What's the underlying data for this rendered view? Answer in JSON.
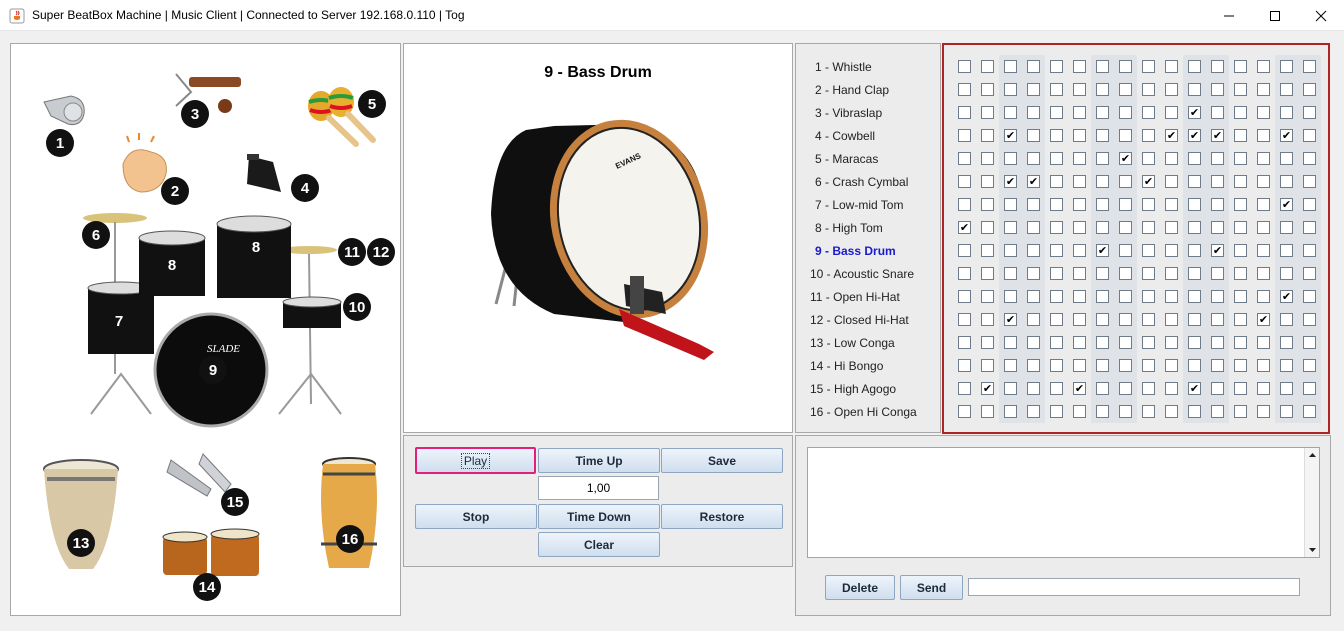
{
  "window": {
    "title": "Super BeatBox Machine | Music Client | Connected to Server 192.168.0.110 | Tog"
  },
  "instrument_image": {
    "numbers": [
      "1",
      "2",
      "3",
      "4",
      "5",
      "6",
      "7",
      "8",
      "8",
      "9",
      "10",
      "11",
      "12",
      "13",
      "14",
      "15",
      "16"
    ]
  },
  "preview": {
    "title": "9 - Bass Drum",
    "drum_brand": "EVANS"
  },
  "controls": {
    "play": "Play",
    "time_up": "Time Up",
    "save": "Save",
    "tempo": "1,00",
    "stop": "Stop",
    "time_down": "Time Down",
    "restore": "Restore",
    "clear": "Clear"
  },
  "instruments": [
    "1 - Whistle",
    "2 - Hand Clap",
    "3 - Vibraslap",
    "4 - Cowbell",
    "5 - Maracas",
    "6 - Crash Cymbal",
    "7 - Low-mid Tom",
    "8 - High Tom",
    "9 - Bass Drum",
    "10 - Acoustic Snare",
    "11 - Open Hi-Hat",
    "12 - Closed Hi-Hat",
    "13 - Low Conga",
    "14 - Hi Bongo",
    "15 - High Agogo",
    "16 - Open Hi Conga"
  ],
  "selected_instrument": 8,
  "pattern": [
    [
      0,
      0,
      0,
      0,
      0,
      0,
      0,
      0,
      0,
      0,
      0,
      0,
      0,
      0,
      0,
      0
    ],
    [
      0,
      0,
      0,
      0,
      0,
      0,
      0,
      0,
      0,
      0,
      0,
      0,
      0,
      0,
      0,
      0
    ],
    [
      0,
      0,
      0,
      0,
      0,
      0,
      0,
      0,
      0,
      0,
      1,
      0,
      0,
      0,
      0,
      0
    ],
    [
      0,
      0,
      1,
      0,
      0,
      0,
      0,
      0,
      0,
      1,
      1,
      1,
      0,
      0,
      1,
      0
    ],
    [
      0,
      0,
      0,
      0,
      0,
      0,
      0,
      1,
      0,
      0,
      0,
      0,
      0,
      0,
      0,
      0
    ],
    [
      0,
      0,
      1,
      1,
      0,
      0,
      0,
      0,
      1,
      0,
      0,
      0,
      0,
      0,
      0,
      0
    ],
    [
      0,
      0,
      0,
      0,
      0,
      0,
      0,
      0,
      0,
      0,
      0,
      0,
      0,
      0,
      1,
      0
    ],
    [
      1,
      0,
      0,
      0,
      0,
      0,
      0,
      0,
      0,
      0,
      0,
      0,
      0,
      0,
      0,
      0
    ],
    [
      0,
      0,
      0,
      0,
      0,
      0,
      1,
      0,
      0,
      0,
      0,
      1,
      0,
      0,
      0,
      0
    ],
    [
      0,
      0,
      0,
      0,
      0,
      0,
      0,
      0,
      0,
      0,
      0,
      0,
      0,
      0,
      0,
      0
    ],
    [
      0,
      0,
      0,
      0,
      0,
      0,
      0,
      0,
      0,
      0,
      0,
      0,
      0,
      0,
      1,
      0
    ],
    [
      0,
      0,
      1,
      0,
      0,
      0,
      0,
      0,
      0,
      0,
      0,
      0,
      0,
      1,
      0,
      0
    ],
    [
      0,
      0,
      0,
      0,
      0,
      0,
      0,
      0,
      0,
      0,
      0,
      0,
      0,
      0,
      0,
      0
    ],
    [
      0,
      0,
      0,
      0,
      0,
      0,
      0,
      0,
      0,
      0,
      0,
      0,
      0,
      0,
      0,
      0
    ],
    [
      0,
      1,
      0,
      0,
      0,
      1,
      0,
      0,
      0,
      0,
      1,
      0,
      0,
      0,
      0,
      0
    ],
    [
      0,
      0,
      0,
      0,
      0,
      0,
      0,
      0,
      0,
      0,
      0,
      0,
      0,
      0,
      0,
      0
    ]
  ],
  "chat": {
    "messages_text": "",
    "delete": "Delete",
    "send": "Send",
    "message_value": ""
  },
  "colors": {
    "grid_border": "#b22222",
    "selected_label": "#1a1acc",
    "focus_border": "#e0207a"
  }
}
